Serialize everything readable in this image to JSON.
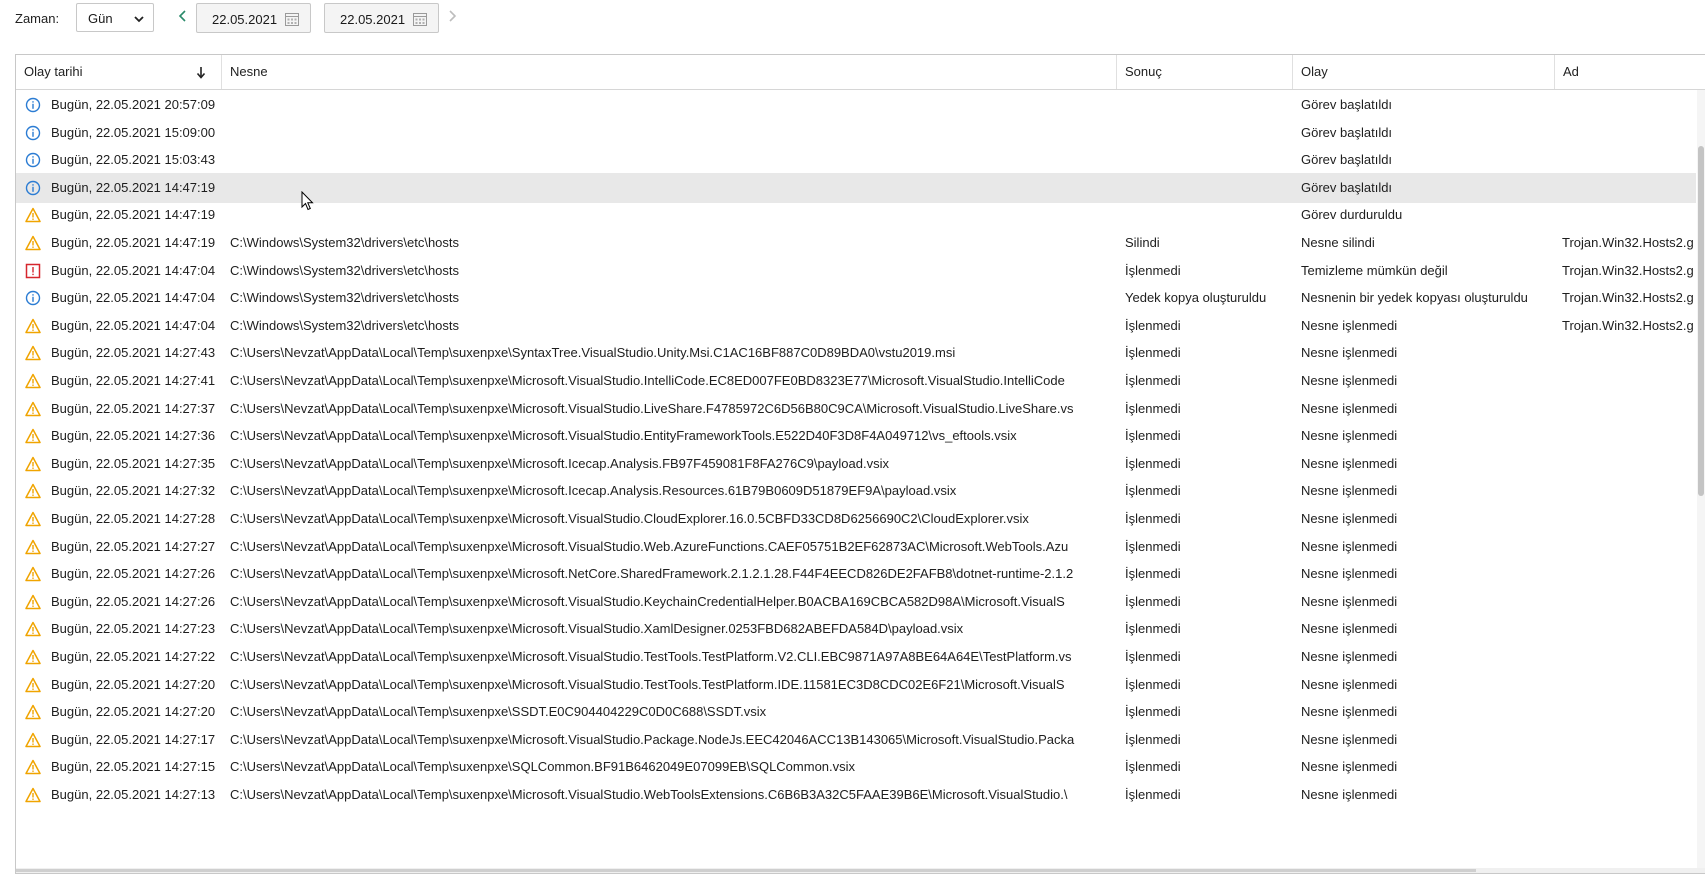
{
  "toolbar": {
    "time_label": "Zaman:",
    "period_value": "Gün",
    "date_from": "22.05.2021",
    "date_to": "22.05.2021"
  },
  "columns": [
    "Olay tarihi",
    "Nesne",
    "Sonuç",
    "Olay",
    "Ad"
  ],
  "rows": [
    {
      "icon": "info",
      "date": "Bugün, 22.05.2021 20:57:09",
      "object": "",
      "result": "",
      "event": "Görev başlatıldı",
      "name": ""
    },
    {
      "icon": "info",
      "date": "Bugün, 22.05.2021 15:09:00",
      "object": "",
      "result": "",
      "event": "Görev başlatıldı",
      "name": ""
    },
    {
      "icon": "info",
      "date": "Bugün, 22.05.2021 15:03:43",
      "object": "",
      "result": "",
      "event": "Görev başlatıldı",
      "name": ""
    },
    {
      "icon": "info",
      "date": "Bugün, 22.05.2021 14:47:19",
      "object": "",
      "result": "",
      "event": "Görev başlatıldı",
      "name": "",
      "highlight": true
    },
    {
      "icon": "warning",
      "date": "Bugün, 22.05.2021 14:47:19",
      "object": "",
      "result": "",
      "event": "Görev durduruldu",
      "name": ""
    },
    {
      "icon": "warning",
      "date": "Bugün, 22.05.2021 14:47:19",
      "object": "C:\\Windows\\System32\\drivers\\etc\\hosts",
      "result": "Silindi",
      "event": "Nesne silindi",
      "name": "Trojan.Win32.Hosts2.g"
    },
    {
      "icon": "error",
      "date": "Bugün, 22.05.2021 14:47:04",
      "object": "C:\\Windows\\System32\\drivers\\etc\\hosts",
      "result": "İşlenmedi",
      "event": "Temizleme mümkün değil",
      "name": "Trojan.Win32.Hosts2.g"
    },
    {
      "icon": "info",
      "date": "Bugün, 22.05.2021 14:47:04",
      "object": "C:\\Windows\\System32\\drivers\\etc\\hosts",
      "result": "Yedek kopya oluşturuldu",
      "event": "Nesnenin bir yedek kopyası oluşturuldu",
      "name": "Trojan.Win32.Hosts2.g"
    },
    {
      "icon": "warning",
      "date": "Bugün, 22.05.2021 14:47:04",
      "object": "C:\\Windows\\System32\\drivers\\etc\\hosts",
      "result": "İşlenmedi",
      "event": "Nesne işlenmedi",
      "name": "Trojan.Win32.Hosts2.g"
    },
    {
      "icon": "warning",
      "date": "Bugün, 22.05.2021 14:27:43",
      "object": "C:\\Users\\Nevzat\\AppData\\Local\\Temp\\suxenpxe\\SyntaxTree.VisualStudio.Unity.Msi.C1AC16BF887C0D89BDA0\\vstu2019.msi",
      "result": "İşlenmedi",
      "event": "Nesne işlenmedi",
      "name": ""
    },
    {
      "icon": "warning",
      "date": "Bugün, 22.05.2021 14:27:41",
      "object": "C:\\Users\\Nevzat\\AppData\\Local\\Temp\\suxenpxe\\Microsoft.VisualStudio.IntelliCode.EC8ED007FE0BD8323E77\\Microsoft.VisualStudio.IntelliCode",
      "result": "İşlenmedi",
      "event": "Nesne işlenmedi",
      "name": ""
    },
    {
      "icon": "warning",
      "date": "Bugün, 22.05.2021 14:27:37",
      "object": "C:\\Users\\Nevzat\\AppData\\Local\\Temp\\suxenpxe\\Microsoft.VisualStudio.LiveShare.F4785972C6D56B80C9CA\\Microsoft.VisualStudio.LiveShare.vs",
      "result": "İşlenmedi",
      "event": "Nesne işlenmedi",
      "name": ""
    },
    {
      "icon": "warning",
      "date": "Bugün, 22.05.2021 14:27:36",
      "object": "C:\\Users\\Nevzat\\AppData\\Local\\Temp\\suxenpxe\\Microsoft.VisualStudio.EntityFrameworkTools.E522D40F3D8F4A049712\\vs_eftools.vsix",
      "result": "İşlenmedi",
      "event": "Nesne işlenmedi",
      "name": ""
    },
    {
      "icon": "warning",
      "date": "Bugün, 22.05.2021 14:27:35",
      "object": "C:\\Users\\Nevzat\\AppData\\Local\\Temp\\suxenpxe\\Microsoft.Icecap.Analysis.FB97F459081F8FA276C9\\payload.vsix",
      "result": "İşlenmedi",
      "event": "Nesne işlenmedi",
      "name": ""
    },
    {
      "icon": "warning",
      "date": "Bugün, 22.05.2021 14:27:32",
      "object": "C:\\Users\\Nevzat\\AppData\\Local\\Temp\\suxenpxe\\Microsoft.Icecap.Analysis.Resources.61B79B0609D51879EF9A\\payload.vsix",
      "result": "İşlenmedi",
      "event": "Nesne işlenmedi",
      "name": ""
    },
    {
      "icon": "warning",
      "date": "Bugün, 22.05.2021 14:27:28",
      "object": "C:\\Users\\Nevzat\\AppData\\Local\\Temp\\suxenpxe\\Microsoft.VisualStudio.CloudExplorer.16.0.5CBFD33CD8D6256690C2\\CloudExplorer.vsix",
      "result": "İşlenmedi",
      "event": "Nesne işlenmedi",
      "name": ""
    },
    {
      "icon": "warning",
      "date": "Bugün, 22.05.2021 14:27:27",
      "object": "C:\\Users\\Nevzat\\AppData\\Local\\Temp\\suxenpxe\\Microsoft.VisualStudio.Web.AzureFunctions.CAEF05751B2EF62873AC\\Microsoft.WebTools.Azu",
      "result": "İşlenmedi",
      "event": "Nesne işlenmedi",
      "name": ""
    },
    {
      "icon": "warning",
      "date": "Bugün, 22.05.2021 14:27:26",
      "object": "C:\\Users\\Nevzat\\AppData\\Local\\Temp\\suxenpxe\\Microsoft.NetCore.SharedFramework.2.1.2.1.28.F44F4EECD826DE2FAFB8\\dotnet-runtime-2.1.2",
      "result": "İşlenmedi",
      "event": "Nesne işlenmedi",
      "name": ""
    },
    {
      "icon": "warning",
      "date": "Bugün, 22.05.2021 14:27:26",
      "object": "C:\\Users\\Nevzat\\AppData\\Local\\Temp\\suxenpxe\\Microsoft.VisualStudio.KeychainCredentialHelper.B0ACBA169CBCA582D98A\\Microsoft.VisualS",
      "result": "İşlenmedi",
      "event": "Nesne işlenmedi",
      "name": ""
    },
    {
      "icon": "warning",
      "date": "Bugün, 22.05.2021 14:27:23",
      "object": "C:\\Users\\Nevzat\\AppData\\Local\\Temp\\suxenpxe\\Microsoft.VisualStudio.XamlDesigner.0253FBD682ABEFDA584D\\payload.vsix",
      "result": "İşlenmedi",
      "event": "Nesne işlenmedi",
      "name": ""
    },
    {
      "icon": "warning",
      "date": "Bugün, 22.05.2021 14:27:22",
      "object": "C:\\Users\\Nevzat\\AppData\\Local\\Temp\\suxenpxe\\Microsoft.VisualStudio.TestTools.TestPlatform.V2.CLI.EBC9871A97A8BE64A64E\\TestPlatform.vs",
      "result": "İşlenmedi",
      "event": "Nesne işlenmedi",
      "name": ""
    },
    {
      "icon": "warning",
      "date": "Bugün, 22.05.2021 14:27:20",
      "object": "C:\\Users\\Nevzat\\AppData\\Local\\Temp\\suxenpxe\\Microsoft.VisualStudio.TestTools.TestPlatform.IDE.11581EC3D8CDC02E6F21\\Microsoft.VisualS",
      "result": "İşlenmedi",
      "event": "Nesne işlenmedi",
      "name": ""
    },
    {
      "icon": "warning",
      "date": "Bugün, 22.05.2021 14:27:20",
      "object": "C:\\Users\\Nevzat\\AppData\\Local\\Temp\\suxenpxe\\SSDT.E0C904404229C0D0C688\\SSDT.vsix",
      "result": "İşlenmedi",
      "event": "Nesne işlenmedi",
      "name": ""
    },
    {
      "icon": "warning",
      "date": "Bugün, 22.05.2021 14:27:17",
      "object": "C:\\Users\\Nevzat\\AppData\\Local\\Temp\\suxenpxe\\Microsoft.VisualStudio.Package.NodeJs.EEC42046ACC13B143065\\Microsoft.VisualStudio.Packa",
      "result": "İşlenmedi",
      "event": "Nesne işlenmedi",
      "name": ""
    },
    {
      "icon": "warning",
      "date": "Bugün, 22.05.2021 14:27:15",
      "object": "C:\\Users\\Nevzat\\AppData\\Local\\Temp\\suxenpxe\\SQLCommon.BF91B6462049E07099EB\\SQLCommon.vsix",
      "result": "İşlenmedi",
      "event": "Nesne işlenmedi",
      "name": ""
    },
    {
      "icon": "warning",
      "date": "Bugün, 22.05.2021 14:27:13",
      "object": "C:\\Users\\Nevzat\\AppData\\Local\\Temp\\suxenpxe\\Microsoft.VisualStudio.WebToolsExtensions.C6B6B3A32C5FAAE39B6E\\Microsoft.VisualStudio.\\",
      "result": "İşlenmedi",
      "event": "Nesne işlenmedi",
      "name": ""
    }
  ],
  "icons": {
    "info": "info-icon",
    "warning": "warning-icon",
    "error": "error-icon"
  },
  "colors": {
    "info": "#2b7cd3",
    "warning": "#f0a400",
    "error": "#d6262d",
    "highlight": "#e8e8e8"
  }
}
